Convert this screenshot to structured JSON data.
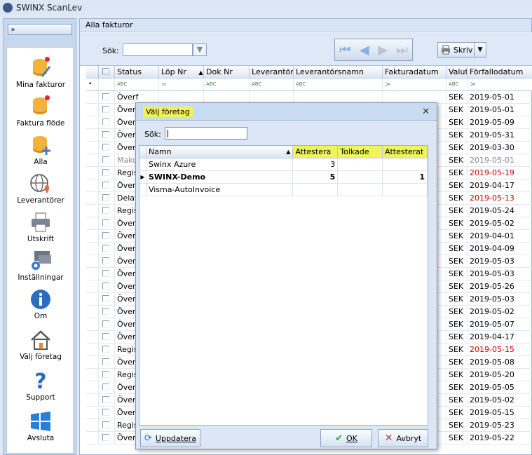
{
  "app": {
    "title": "SWINX ScanLev",
    "collapse_label": "»"
  },
  "sidebar": {
    "items": [
      {
        "label": "Mina fakturor",
        "icon": "database-edit-icon"
      },
      {
        "label": "Faktura flöde",
        "icon": "database-flow-icon"
      },
      {
        "label": "Alla",
        "icon": "database-add-icon"
      },
      {
        "label": "Leverantörer",
        "icon": "globe-location-icon"
      },
      {
        "label": "Utskrift",
        "icon": "printer-icon"
      },
      {
        "label": "Inställningar",
        "icon": "settings-icon"
      },
      {
        "label": "Om",
        "icon": "info-icon"
      },
      {
        "label": "Välj företag",
        "icon": "home-icon"
      },
      {
        "label": "Support",
        "icon": "question-icon"
      },
      {
        "label": "Avsluta",
        "icon": "windows-icon"
      }
    ]
  },
  "main": {
    "tab_title": "Alla fakturor",
    "search_label": "Sök:",
    "search_value": "",
    "print_label": "Skriv"
  },
  "grid": {
    "columns": [
      "Status",
      "Löp Nr",
      "Dok Nr",
      "Leverantörsi",
      "Leverantörsnamn",
      "Fakturadatum",
      "Valut",
      "Förfallodatum"
    ],
    "rows": [
      {
        "status": "Överf",
        "currency": "SEK",
        "due": "2019-05-01",
        "overdue": false
      },
      {
        "status": "Överf",
        "currency": "SEK",
        "due": "2019-05-01",
        "overdue": false
      },
      {
        "status": "Överf",
        "currency": "SEK",
        "due": "2019-05-09",
        "overdue": false
      },
      {
        "status": "Överf",
        "currency": "SEK",
        "due": "2019-05-31",
        "overdue": false
      },
      {
        "status": "Överf",
        "currency": "SEK",
        "due": "2019-03-30",
        "overdue": false
      },
      {
        "status": "Maku",
        "currency": "SEK",
        "due": "2019-05-01",
        "overdue": false,
        "muted": true
      },
      {
        "status": "Regis",
        "currency": "SEK",
        "due": "2019-05-19",
        "overdue": true
      },
      {
        "status": "Överf",
        "currency": "SEK",
        "due": "2019-04-17",
        "overdue": false
      },
      {
        "status": "Delat",
        "currency": "SEK",
        "due": "2019-05-13",
        "overdue": true
      },
      {
        "status": "Regis",
        "currency": "SEK",
        "due": "2019-05-24",
        "overdue": false
      },
      {
        "status": "Överf",
        "currency": "SEK",
        "due": "2019-05-02",
        "overdue": false
      },
      {
        "status": "Överf",
        "currency": "SEK",
        "due": "2019-04-01",
        "overdue": false
      },
      {
        "status": "Överf",
        "currency": "SEK",
        "due": "2019-04-09",
        "overdue": false
      },
      {
        "status": "Överf",
        "currency": "SEK",
        "due": "2019-05-03",
        "overdue": false
      },
      {
        "status": "Överf",
        "currency": "SEK",
        "due": "2019-05-03",
        "overdue": false
      },
      {
        "status": "Överf",
        "currency": "SEK",
        "due": "2019-05-26",
        "overdue": false
      },
      {
        "status": "Överf",
        "currency": "SEK",
        "due": "2019-05-03",
        "overdue": false
      },
      {
        "status": "Överf",
        "currency": "SEK",
        "due": "2019-05-02",
        "overdue": false
      },
      {
        "status": "Överf",
        "currency": "SEK",
        "due": "2019-05-07",
        "overdue": false
      },
      {
        "status": "Överf",
        "currency": "SEK",
        "due": "2019-04-17",
        "overdue": false
      },
      {
        "status": "Regis",
        "currency": "SEK",
        "due": "2019-05-15",
        "overdue": true
      },
      {
        "status": "Överf",
        "currency": "SEK",
        "due": "2019-05-08",
        "overdue": false
      },
      {
        "status": "Regis",
        "currency": "SEK",
        "due": "2019-05-20",
        "overdue": false
      },
      {
        "status": "Överf",
        "currency": "SEK",
        "due": "2019-05-05",
        "overdue": false
      },
      {
        "status": "Överf",
        "currency": "SEK",
        "due": "2019-05-02",
        "overdue": false
      },
      {
        "status": "Överf",
        "currency": "SEK",
        "due": "2019-05-15",
        "overdue": false
      },
      {
        "status": "Regis",
        "currency": "SEK",
        "due": "2019-05-23",
        "overdue": false
      },
      {
        "status": "Överf",
        "currency": "SEK",
        "due": "2019-05-22",
        "overdue": false
      }
    ]
  },
  "modal": {
    "title": "Välj företag",
    "search_label": "Sök:",
    "search_value": "",
    "columns": [
      "Namn",
      "Attestera",
      "Tolkade",
      "Attesterat"
    ],
    "rows": [
      {
        "name": "Swinx Azure",
        "attestera": "3",
        "tolkade": "",
        "attesterat": "",
        "selected": false
      },
      {
        "name": "SWINX-Demo",
        "attestera": "5",
        "tolkade": "",
        "attesterat": "1",
        "selected": true
      },
      {
        "name": "Visma-AutoInvoice",
        "attestera": "",
        "tolkade": "",
        "attesterat": "",
        "selected": false
      }
    ],
    "refresh_label": "Uppdatera",
    "ok_label": "OK",
    "cancel_label": "Avbryt"
  },
  "colors": {
    "highlight": "#f2f35a",
    "overdue": "#cc0000",
    "accent": "#4a78c2"
  }
}
